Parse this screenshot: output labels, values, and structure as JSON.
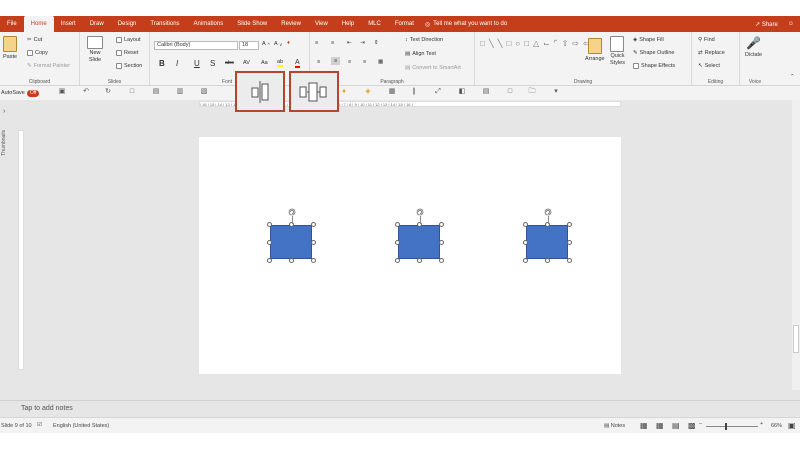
{
  "tabs": [
    "File",
    "Home",
    "Insert",
    "Draw",
    "Design",
    "Transitions",
    "Animations",
    "Slide Show",
    "Review",
    "View",
    "Help",
    "MLC",
    "Format"
  ],
  "active_tab": "Home",
  "tellme": "Tell me what you want to do",
  "share": "Share",
  "ribbon": {
    "clipboard": {
      "paste": "Paste",
      "cut": "Cut",
      "copy": "Copy",
      "format_painter": "Format Painter",
      "label": "Clipboard"
    },
    "slides": {
      "new_slide": "New",
      "new_slide2": "Slide",
      "layout": "Layout",
      "reset": "Reset",
      "section": "Section",
      "label": "Slides"
    },
    "font": {
      "name": "Calibri (Body)",
      "size": "18",
      "bold": "B",
      "italic": "I",
      "underline": "U",
      "shadow": "S",
      "strike": "abc",
      "spacing": "AV",
      "case": "Aa",
      "label": "Font"
    },
    "paragraph": {
      "text_direction": "Text Direction",
      "align_text": "Align Text",
      "smartart": "Convert to SmartArt",
      "label": "Paragraph"
    },
    "drawing": {
      "arrange": "Arrange",
      "quick_styles": "Quick",
      "quick_styles2": "Styles",
      "shape_fill": "Shape Fill",
      "shape_outline": "Shape Outline",
      "shape_effects": "Shape Effects",
      "label": "Drawing"
    },
    "editing": {
      "find": "Find",
      "replace": "Replace",
      "select": "Select",
      "label": "Editing"
    },
    "voice": {
      "dictate": "Dictate",
      "label": "Voice"
    }
  },
  "qat": {
    "autosave": "AutoSave",
    "toggle": "Off"
  },
  "thumbnails": "Thumbnails",
  "ruler_text": "| 16 | 15 | 14 | 13 | 12 | 11 | 10 | 9 | 8 | 7 | 6 | 5 | 4 | 3 | 2 | 1 | 0 | 1 | 2 | 3 | 4 | 5 | 6 | 7 | 8 | 9 | 10 | 11 | 12 | 13 | 14 | 15 | 16 |",
  "notes_placeholder": "Tap to add notes",
  "status": {
    "slide": "Slide 9 of 10",
    "language": "English (United States)",
    "notes": "Notes",
    "zoom": "66%"
  },
  "colors": {
    "accent": "#c43e1c",
    "shape_fill": "#4472c4",
    "highlight": "#b5462b"
  }
}
